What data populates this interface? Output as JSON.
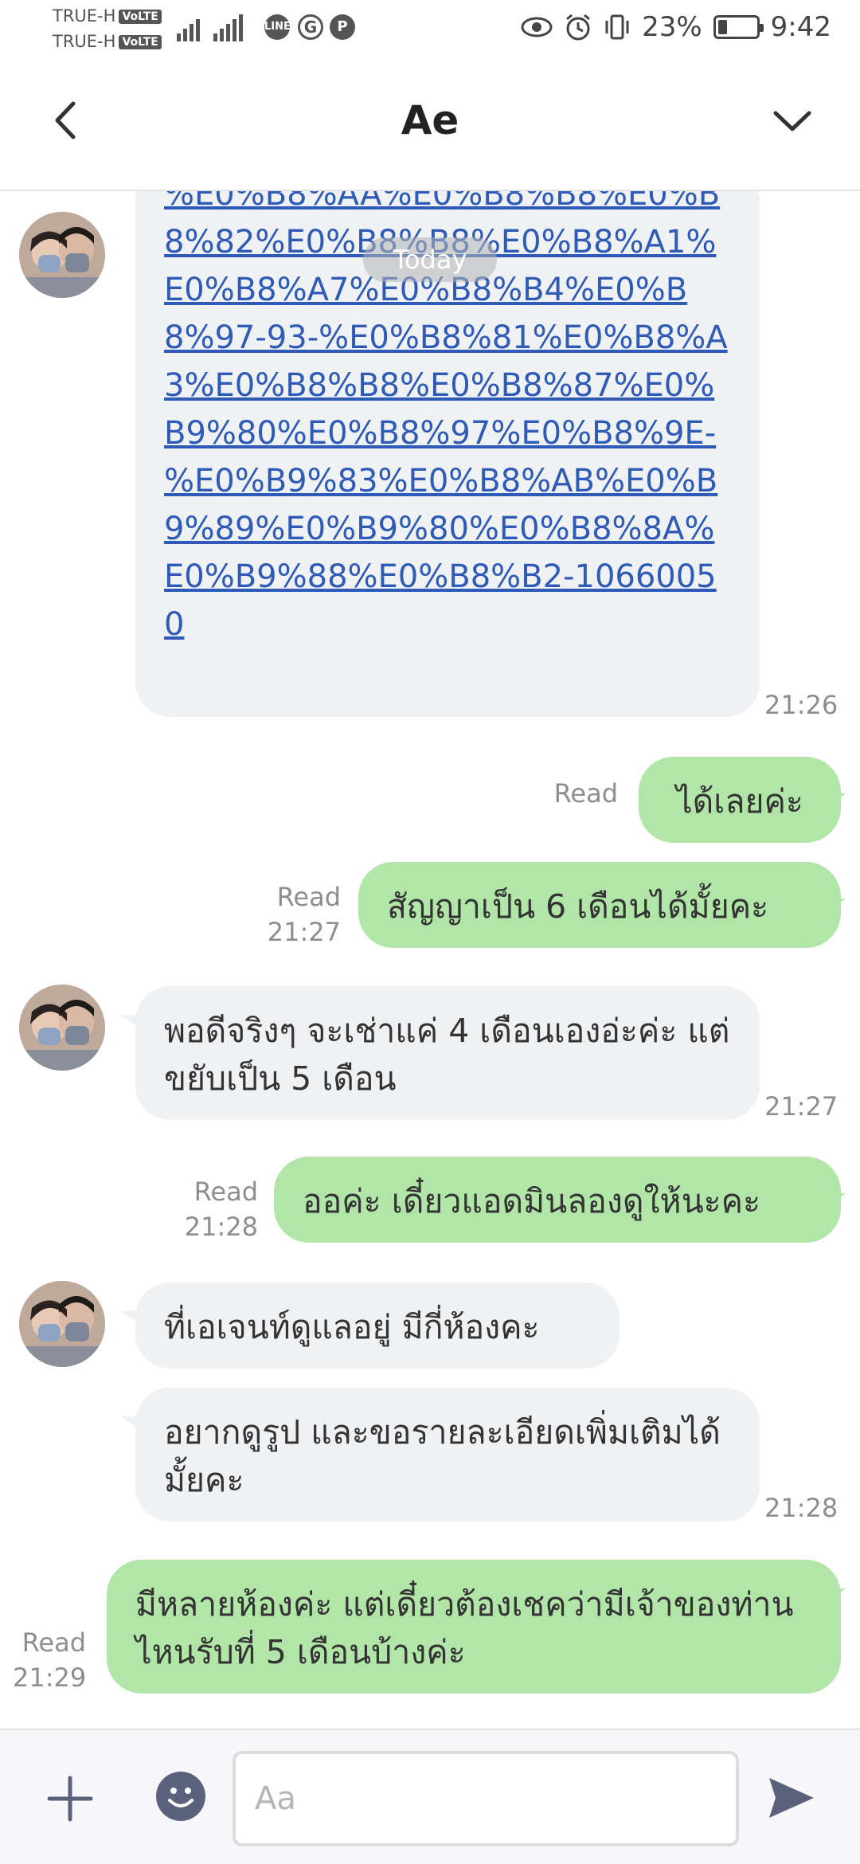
{
  "status_bar": {
    "carrier1": "TRUE-H",
    "carrier2": "TRUE-H",
    "volte": "VoLTE",
    "network": "4G",
    "battery": "23%",
    "battery_level": 0.23,
    "time": "9:42"
  },
  "header": {
    "title": "Ae"
  },
  "chat": {
    "date_label": "Today",
    "messages": [
      {
        "direction": "in",
        "text": "%E0%B8%AA%E0%B8%B8%E0%B8%82%E0%B8%B8%E0%B8%A1%E0%B8%A7%E0%B8%B4%E0%B8%97-93-%E0%B8%81%E0%B8%A3%E0%B8%B8%E0%B8%87%E0%B9%80%E0%B8%97%E0%B8%9E-%E0%B9%83%E0%B8%AB%E0%B9%89%E0%B9%80%E0%B8%8A%E0%B9%88%E0%B8%B2-10660050",
        "time": "21:26"
      },
      {
        "direction": "out",
        "text": "ได้เลยค่ะ",
        "read": "Read",
        "time": ""
      },
      {
        "direction": "out",
        "text": "สัญญาเป็น 6 เดือนได้มั้ยคะ",
        "read": "Read",
        "time": "21:27"
      },
      {
        "direction": "in",
        "text": "พอดีจริงๆ จะเช่าแค่ 4 เดือนเองอ่ะค่ะ แต่ขยับเป็น 5 เดือน",
        "time": "21:27"
      },
      {
        "direction": "out",
        "text": "ออค่ะ เดี๋ยวแอดมินลองดูให้นะคะ",
        "read": "Read",
        "time": "21:28"
      },
      {
        "direction": "in",
        "text": "ที่เอเจนท์ดูแลอยู่ มีกี่ห้องคะ",
        "time": ""
      },
      {
        "direction": "in",
        "text": "อยากดูรูป และขอรายละเอียดเพิ่มเติมได้มั้ยคะ",
        "time": "21:28"
      },
      {
        "direction": "out",
        "text": "มีหลายห้องค่ะ แต่เดี๋ยวต้องเชคว่ามีเจ้าของท่านไหนรับที่ 5 เดือนบ้างค่ะ",
        "read": "Read",
        "time": "21:29"
      }
    ]
  },
  "input_bar": {
    "placeholder": "Aa"
  }
}
